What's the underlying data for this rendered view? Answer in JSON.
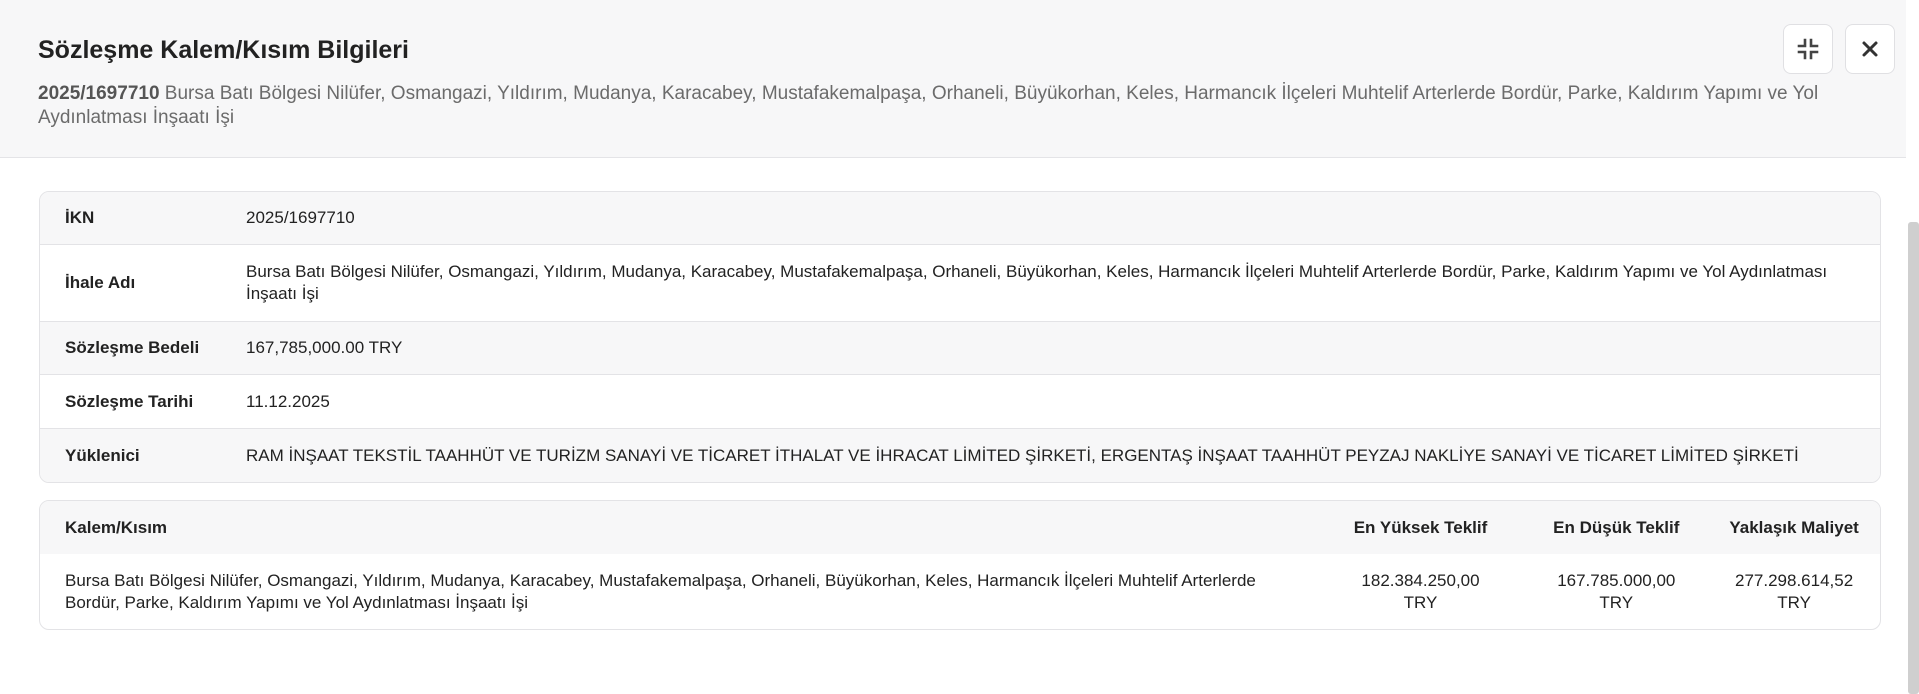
{
  "header": {
    "title": "Sözleşme Kalem/Kısım Bilgileri",
    "ikn": "2025/1697710",
    "tender_name": "Bursa Batı Bölgesi Nilüfer, Osmangazi, Yıldırım, Mudanya, Karacabey, Mustafakemalpaşa, Orhaneli, Büyükorhan, Keles, Harmancık İlçeleri Muhtelif Arterlerde Bordür, Parke, Kaldırım Yapımı ve Yol Aydınlatması İnşaatı İşi",
    "compress_icon": "compress-icon",
    "close_icon": "close-icon"
  },
  "info": {
    "ikn_label": "İKN",
    "ikn_value": "2025/1697710",
    "name_label": "İhale Adı",
    "name_value": "Bursa Batı Bölgesi Nilüfer, Osmangazi, Yıldırım, Mudanya, Karacabey, Mustafakemalpaşa, Orhaneli, Büyükorhan, Keles, Harmancık İlçeleri Muhtelif Arterlerde Bordür, Parke, Kaldırım Yapımı ve Yol Aydınlatması İnşaatı İşi",
    "price_label": "Sözleşme Bedeli",
    "price_value": "167,785,000.00 TRY",
    "date_label": "Sözleşme Tarihi",
    "date_value": "11.12.2025",
    "contractor_label": "Yüklenici",
    "contractor_value": "RAM İNŞAAT TEKSTİL TAAHHÜT VE TURİZM SANAYİ VE TİCARET İTHALAT VE İHRACAT LİMİTED ŞİRKETİ, ERGENTAŞ İNŞAAT TAAHHÜT PEYZAJ NAKLİYE SANAYİ VE TİCARET LİMİTED ŞİRKETİ"
  },
  "items": {
    "columns": {
      "name": "Kalem/Kısım",
      "max_offer": "En Yüksek Teklif",
      "min_offer": "En Düşük Teklif",
      "estimated_cost": "Yaklaşık Maliyet"
    },
    "rows": [
      {
        "name": "Bursa Batı Bölgesi Nilüfer, Osmangazi, Yıldırım, Mudanya, Karacabey, Mustafakemalpaşa, Orhaneli, Büyükorhan, Keles, Harmancık İlçeleri Muhtelif Arterlerde Bordür, Parke, Kaldırım Yapımı ve Yol Aydınlatması İnşaatı İşi",
        "max_offer": "182.384.250,00",
        "min_offer": "167.785.000,00",
        "estimated_cost": "277.298.614,52",
        "currency": "TRY"
      }
    ]
  }
}
